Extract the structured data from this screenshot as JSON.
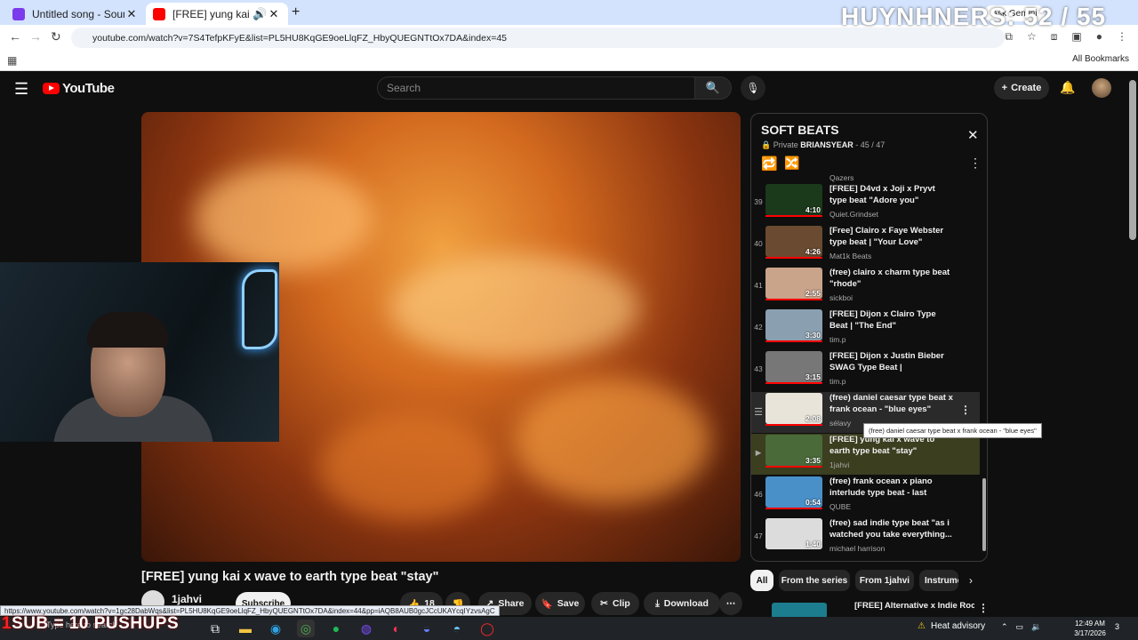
{
  "browser": {
    "tabs": [
      {
        "title": "Untitled song - Soundtrap",
        "close": "✕"
      },
      {
        "title": "[FREE] yung kai x wave to e",
        "close": "✕"
      }
    ],
    "new_tab": "+",
    "url": "youtube.com/watch?v=7S4TefpKFyE&list=PL5HU8KqGE9oeLlqFZ_HbyQUEGNTtOx7DA&index=45",
    "bookmarks_label": "All Bookmarks",
    "gemini_label": "Ask Gemini"
  },
  "overlay": {
    "counter": "HUYNHNERS: 52 / 55",
    "pushups_prefix": "1",
    "pushups_text": "SUB = 10 PUSHUPS"
  },
  "youtube": {
    "logo": "YouTube",
    "search_placeholder": "Search",
    "create_label": "Create",
    "video_title": "[FREE] yung kai x wave to earth type beat \"stay\"",
    "channel": "1jahvi",
    "subscribe": "Subscribe",
    "actions": {
      "likes": "18",
      "share": "Share",
      "save": "Save",
      "clip": "Clip",
      "download": "Download"
    }
  },
  "playlist": {
    "title": "SOFT BEATS",
    "privacy": "Private",
    "owner": "BRIANSYEAR",
    "position": "- 45 / 47",
    "prev_channel": "Qazers",
    "items": [
      {
        "idx": "39",
        "title": "[FREE] D4vd x Joji x Pryvt type beat \"Adore you\"",
        "channel": "Quiet.Grindset",
        "duration": "4:10",
        "thumb": "#1b3a1b"
      },
      {
        "idx": "40",
        "title": "[Free] Clairo x Faye Webster type beat | \"Your Love\"",
        "channel": "Mat1k Beats",
        "duration": "4:26",
        "thumb": "#6a4a30"
      },
      {
        "idx": "41",
        "title": "(free) clairo x charm type beat \"rhode\"",
        "channel": "sickboi",
        "duration": "2:55",
        "thumb": "#c9a38a"
      },
      {
        "idx": "42",
        "title": "[FREE] Dijon x Clairo Type Beat | \"The End\"",
        "channel": "tim.p",
        "duration": "3:30",
        "thumb": "#8aa0b0"
      },
      {
        "idx": "43",
        "title": "[FREE] Dijon x Justin Bieber SWAG Type Beat | \"Eventually\"",
        "channel": "tim.p",
        "duration": "3:15",
        "thumb": "#777777"
      },
      {
        "idx": "",
        "title": "(free) daniel caesar type beat x frank ocean - \"blue eyes\"",
        "channel": "sélavy",
        "duration": "2:08",
        "thumb": "#e8e4da"
      },
      {
        "idx": "▶",
        "title": "[FREE] yung kai x wave to earth type beat \"stay\"",
        "channel": "1jahvi",
        "duration": "3:35",
        "thumb": "#4a6a3a"
      },
      {
        "idx": "46",
        "title": "(free) frank ocean x piano interlude type beat - last breath",
        "channel": "QUBE",
        "duration": "0:54",
        "thumb": "#4a90c8"
      },
      {
        "idx": "47",
        "title": "(free) sad indie type beat \"as i watched you take everything...",
        "channel": "michael harrison",
        "duration": "1:40",
        "thumb": "#dcdcdc"
      }
    ],
    "tooltip": "(free) daniel caesar type beat x frank ocean - \"blue eyes\""
  },
  "chips": [
    "All",
    "From the series",
    "From 1jahvi",
    "Instrumental"
  ],
  "recommended": {
    "title": "[FREE] Alternative x Indie Rock Type Beat - \"Heroin\""
  },
  "status_url": "https://www.youtube.com/watch?v=1gc28DabWqs&list=PL5HU8KqGE9oeLlqFZ_HbyQUEGNTtOx7DA&index=44&pp=iAQB8AUB0gcJCcUKAYcqIYzvsAgC",
  "taskbar": {
    "search": "Type here to search",
    "weather": "Heat advisory",
    "time": "12:49 AM",
    "date": "3/17/2026",
    "notifications": "3"
  },
  "colors": {
    "youtube_red": "#ff0000",
    "active_row": "#3b3e1f",
    "chrome_tabbar": "#d3e3fd"
  }
}
